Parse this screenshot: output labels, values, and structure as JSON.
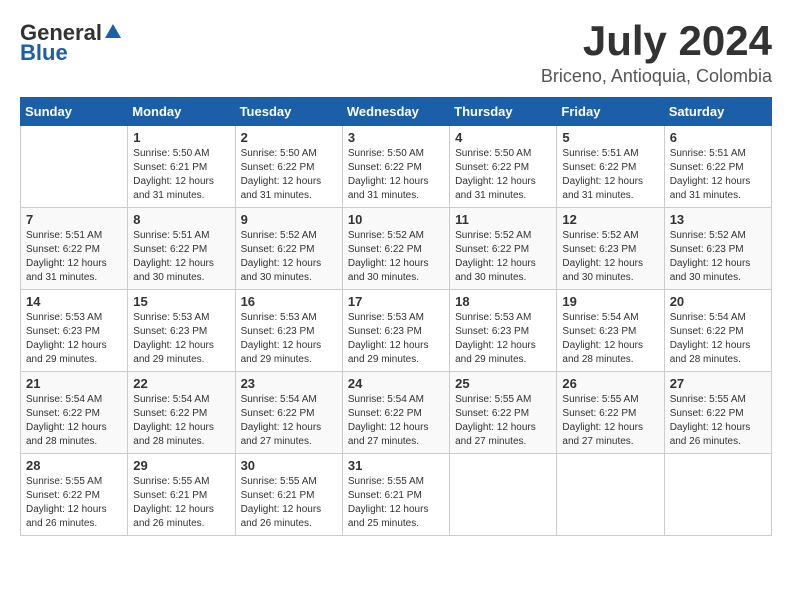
{
  "header": {
    "logo_general": "General",
    "logo_blue": "Blue",
    "title": "July 2024",
    "subtitle": "Briceno, Antioquia, Colombia"
  },
  "calendar": {
    "days_of_week": [
      "Sunday",
      "Monday",
      "Tuesday",
      "Wednesday",
      "Thursday",
      "Friday",
      "Saturday"
    ],
    "weeks": [
      [
        {
          "day": "",
          "info": ""
        },
        {
          "day": "1",
          "info": "Sunrise: 5:50 AM\nSunset: 6:21 PM\nDaylight: 12 hours\nand 31 minutes."
        },
        {
          "day": "2",
          "info": "Sunrise: 5:50 AM\nSunset: 6:22 PM\nDaylight: 12 hours\nand 31 minutes."
        },
        {
          "day": "3",
          "info": "Sunrise: 5:50 AM\nSunset: 6:22 PM\nDaylight: 12 hours\nand 31 minutes."
        },
        {
          "day": "4",
          "info": "Sunrise: 5:50 AM\nSunset: 6:22 PM\nDaylight: 12 hours\nand 31 minutes."
        },
        {
          "day": "5",
          "info": "Sunrise: 5:51 AM\nSunset: 6:22 PM\nDaylight: 12 hours\nand 31 minutes."
        },
        {
          "day": "6",
          "info": "Sunrise: 5:51 AM\nSunset: 6:22 PM\nDaylight: 12 hours\nand 31 minutes."
        }
      ],
      [
        {
          "day": "7",
          "info": "Sunrise: 5:51 AM\nSunset: 6:22 PM\nDaylight: 12 hours\nand 31 minutes."
        },
        {
          "day": "8",
          "info": "Sunrise: 5:51 AM\nSunset: 6:22 PM\nDaylight: 12 hours\nand 30 minutes."
        },
        {
          "day": "9",
          "info": "Sunrise: 5:52 AM\nSunset: 6:22 PM\nDaylight: 12 hours\nand 30 minutes."
        },
        {
          "day": "10",
          "info": "Sunrise: 5:52 AM\nSunset: 6:22 PM\nDaylight: 12 hours\nand 30 minutes."
        },
        {
          "day": "11",
          "info": "Sunrise: 5:52 AM\nSunset: 6:22 PM\nDaylight: 12 hours\nand 30 minutes."
        },
        {
          "day": "12",
          "info": "Sunrise: 5:52 AM\nSunset: 6:23 PM\nDaylight: 12 hours\nand 30 minutes."
        },
        {
          "day": "13",
          "info": "Sunrise: 5:52 AM\nSunset: 6:23 PM\nDaylight: 12 hours\nand 30 minutes."
        }
      ],
      [
        {
          "day": "14",
          "info": "Sunrise: 5:53 AM\nSunset: 6:23 PM\nDaylight: 12 hours\nand 29 minutes."
        },
        {
          "day": "15",
          "info": "Sunrise: 5:53 AM\nSunset: 6:23 PM\nDaylight: 12 hours\nand 29 minutes."
        },
        {
          "day": "16",
          "info": "Sunrise: 5:53 AM\nSunset: 6:23 PM\nDaylight: 12 hours\nand 29 minutes."
        },
        {
          "day": "17",
          "info": "Sunrise: 5:53 AM\nSunset: 6:23 PM\nDaylight: 12 hours\nand 29 minutes."
        },
        {
          "day": "18",
          "info": "Sunrise: 5:53 AM\nSunset: 6:23 PM\nDaylight: 12 hours\nand 29 minutes."
        },
        {
          "day": "19",
          "info": "Sunrise: 5:54 AM\nSunset: 6:23 PM\nDaylight: 12 hours\nand 28 minutes."
        },
        {
          "day": "20",
          "info": "Sunrise: 5:54 AM\nSunset: 6:22 PM\nDaylight: 12 hours\nand 28 minutes."
        }
      ],
      [
        {
          "day": "21",
          "info": "Sunrise: 5:54 AM\nSunset: 6:22 PM\nDaylight: 12 hours\nand 28 minutes."
        },
        {
          "day": "22",
          "info": "Sunrise: 5:54 AM\nSunset: 6:22 PM\nDaylight: 12 hours\nand 28 minutes."
        },
        {
          "day": "23",
          "info": "Sunrise: 5:54 AM\nSunset: 6:22 PM\nDaylight: 12 hours\nand 27 minutes."
        },
        {
          "day": "24",
          "info": "Sunrise: 5:54 AM\nSunset: 6:22 PM\nDaylight: 12 hours\nand 27 minutes."
        },
        {
          "day": "25",
          "info": "Sunrise: 5:55 AM\nSunset: 6:22 PM\nDaylight: 12 hours\nand 27 minutes."
        },
        {
          "day": "26",
          "info": "Sunrise: 5:55 AM\nSunset: 6:22 PM\nDaylight: 12 hours\nand 27 minutes."
        },
        {
          "day": "27",
          "info": "Sunrise: 5:55 AM\nSunset: 6:22 PM\nDaylight: 12 hours\nand 26 minutes."
        }
      ],
      [
        {
          "day": "28",
          "info": "Sunrise: 5:55 AM\nSunset: 6:22 PM\nDaylight: 12 hours\nand 26 minutes."
        },
        {
          "day": "29",
          "info": "Sunrise: 5:55 AM\nSunset: 6:21 PM\nDaylight: 12 hours\nand 26 minutes."
        },
        {
          "day": "30",
          "info": "Sunrise: 5:55 AM\nSunset: 6:21 PM\nDaylight: 12 hours\nand 26 minutes."
        },
        {
          "day": "31",
          "info": "Sunrise: 5:55 AM\nSunset: 6:21 PM\nDaylight: 12 hours\nand 25 minutes."
        },
        {
          "day": "",
          "info": ""
        },
        {
          "day": "",
          "info": ""
        },
        {
          "day": "",
          "info": ""
        }
      ]
    ]
  }
}
